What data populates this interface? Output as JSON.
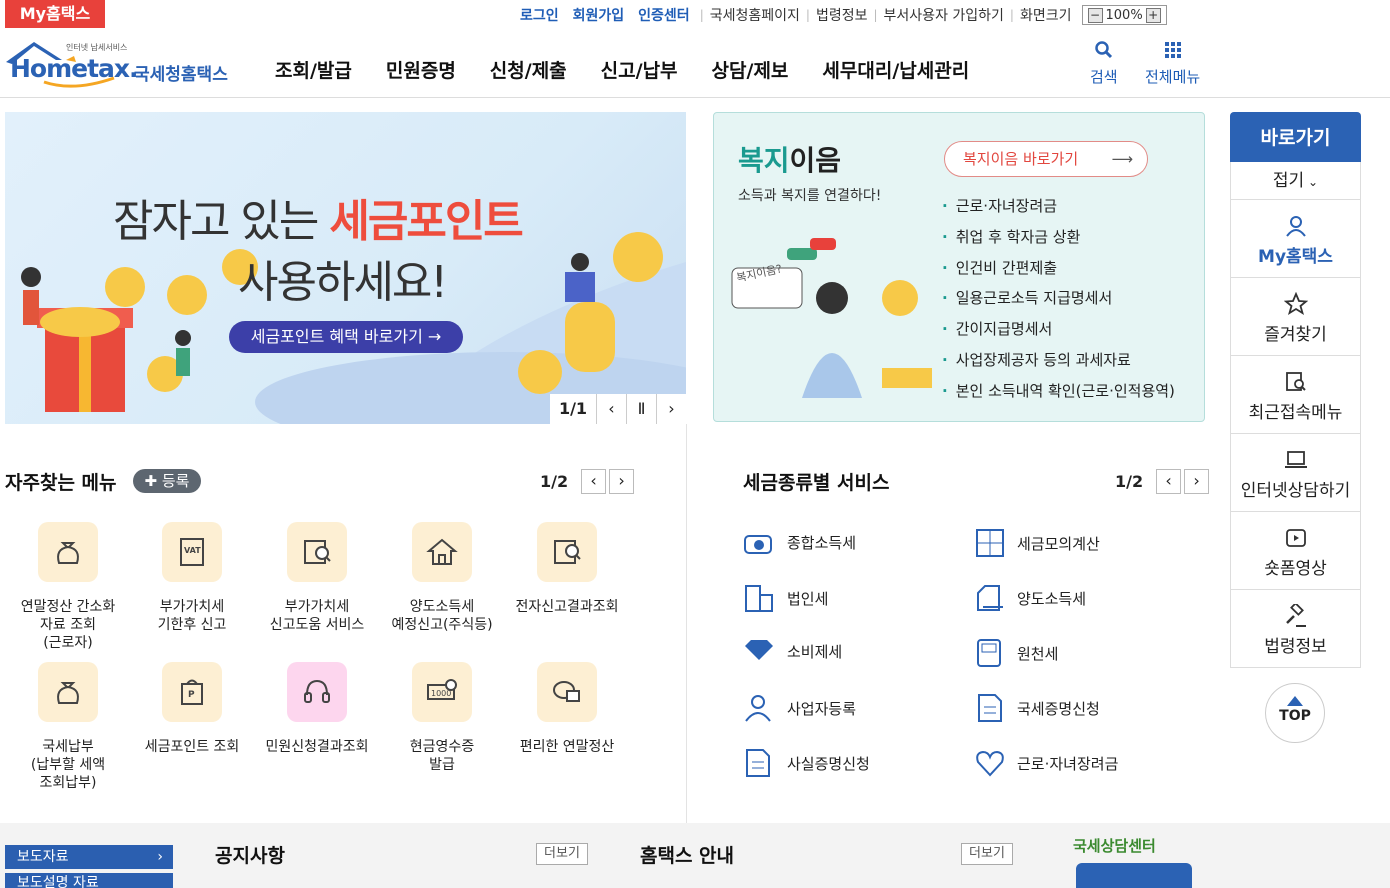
{
  "top": {
    "my_tab": "My홈택스",
    "login": "로그인",
    "signup": "회원가입",
    "cert": "인증센터",
    "links": [
      "국세청홈페이지",
      "법령정보",
      "부서사용자 가입하기",
      "화면크기"
    ],
    "zoom": "100%"
  },
  "header": {
    "brand_small": "인터넷 납세서비스",
    "brand": "Hometax.",
    "brand_kr": "국세청홈택스",
    "nav": [
      "조회/발급",
      "민원증명",
      "신청/제출",
      "신고/납부",
      "상담/제보",
      "세무대리/납세관리"
    ],
    "search": "검색",
    "all_menu": "전체메뉴"
  },
  "banner": {
    "line1a": "잠자고 있는 ",
    "line1b": "세금포인트",
    "line2": "사용하세요!",
    "button": "세금포인트 혜택 바로가기 →",
    "page": "1/1"
  },
  "welfare": {
    "title_a": "복지",
    "title_b": "이음",
    "subtitle": "소득과 복지를 연결하다!",
    "button": "복지이음 바로가기",
    "bubble": "복지이음?",
    "items": [
      "근로·자녀장려금",
      "취업 후 학자금 상환",
      "인건비 간편제출",
      "일용근로소득 지급명세서",
      "간이지급명세서",
      "사업장제공자 등의 과세자료",
      "본인 소득내역 확인(근로·인적용역)"
    ]
  },
  "side": {
    "title": "바로가기",
    "fold": "접기",
    "items": [
      "My홈택스",
      "즐겨찾기",
      "최근접속메뉴",
      "인터넷상담하기",
      "숏폼영상",
      "법령정보"
    ],
    "top": "TOP"
  },
  "frequent": {
    "title": "자주찾는 메뉴",
    "register": "등록",
    "page": "1/2",
    "items": [
      [
        "연말정산 간소화",
        "자료 조회",
        "(근로자)"
      ],
      [
        "부가가치세",
        "기한후 신고"
      ],
      [
        "부가가치세",
        "신고도움 서비스"
      ],
      [
        "양도소득세",
        "예정신고(주식등)"
      ],
      [
        "전자신고결과조회"
      ],
      [
        "국세납부",
        "(납부할 세액",
        "조회납부)"
      ],
      [
        "세금포인트 조회"
      ],
      [
        "민원신청결과조회"
      ],
      [
        "현금영수증",
        "발급"
      ],
      [
        "편리한 연말정산"
      ]
    ]
  },
  "taxsvc": {
    "title": "세금종류별 서비스",
    "page": "1/2",
    "items": [
      "종합소득세",
      "세금모의계산",
      "법인세",
      "양도소득세",
      "소비제세",
      "원천세",
      "사업자등록",
      "국세증명신청",
      "사실증명신청",
      "근로·자녀장려금"
    ]
  },
  "footer": {
    "press": "보도자료",
    "press2": "보도설명 자료",
    "notice": "공지사항",
    "more": "더보기",
    "guide": "홈택스 안내",
    "more2": "더보기",
    "center": "국세상담센터"
  }
}
